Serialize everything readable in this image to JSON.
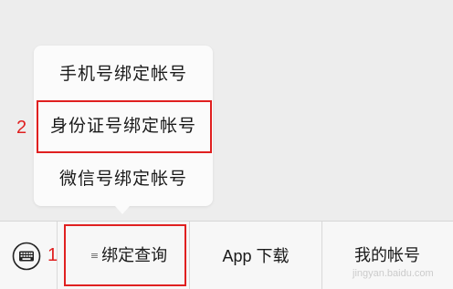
{
  "popup": {
    "items": [
      {
        "label": "手机号绑定帐号"
      },
      {
        "label": "身份证号绑定帐号"
      },
      {
        "label": "微信号绑定帐号"
      }
    ]
  },
  "annotations": {
    "menu_marker": "2",
    "tab_marker": "1"
  },
  "bottom_bar": {
    "keyboard_icon": "keyboard-icon",
    "menu_icon": "menu-lines-icon",
    "tabs": [
      {
        "label": "绑定查询"
      },
      {
        "label": "App 下载"
      },
      {
        "label": "我的帐号"
      }
    ]
  },
  "watermark": {
    "text": "jingyan.baidu.com"
  },
  "colors": {
    "highlight": "#e02020",
    "background": "#ededed",
    "bar": "#f7f7f7"
  }
}
